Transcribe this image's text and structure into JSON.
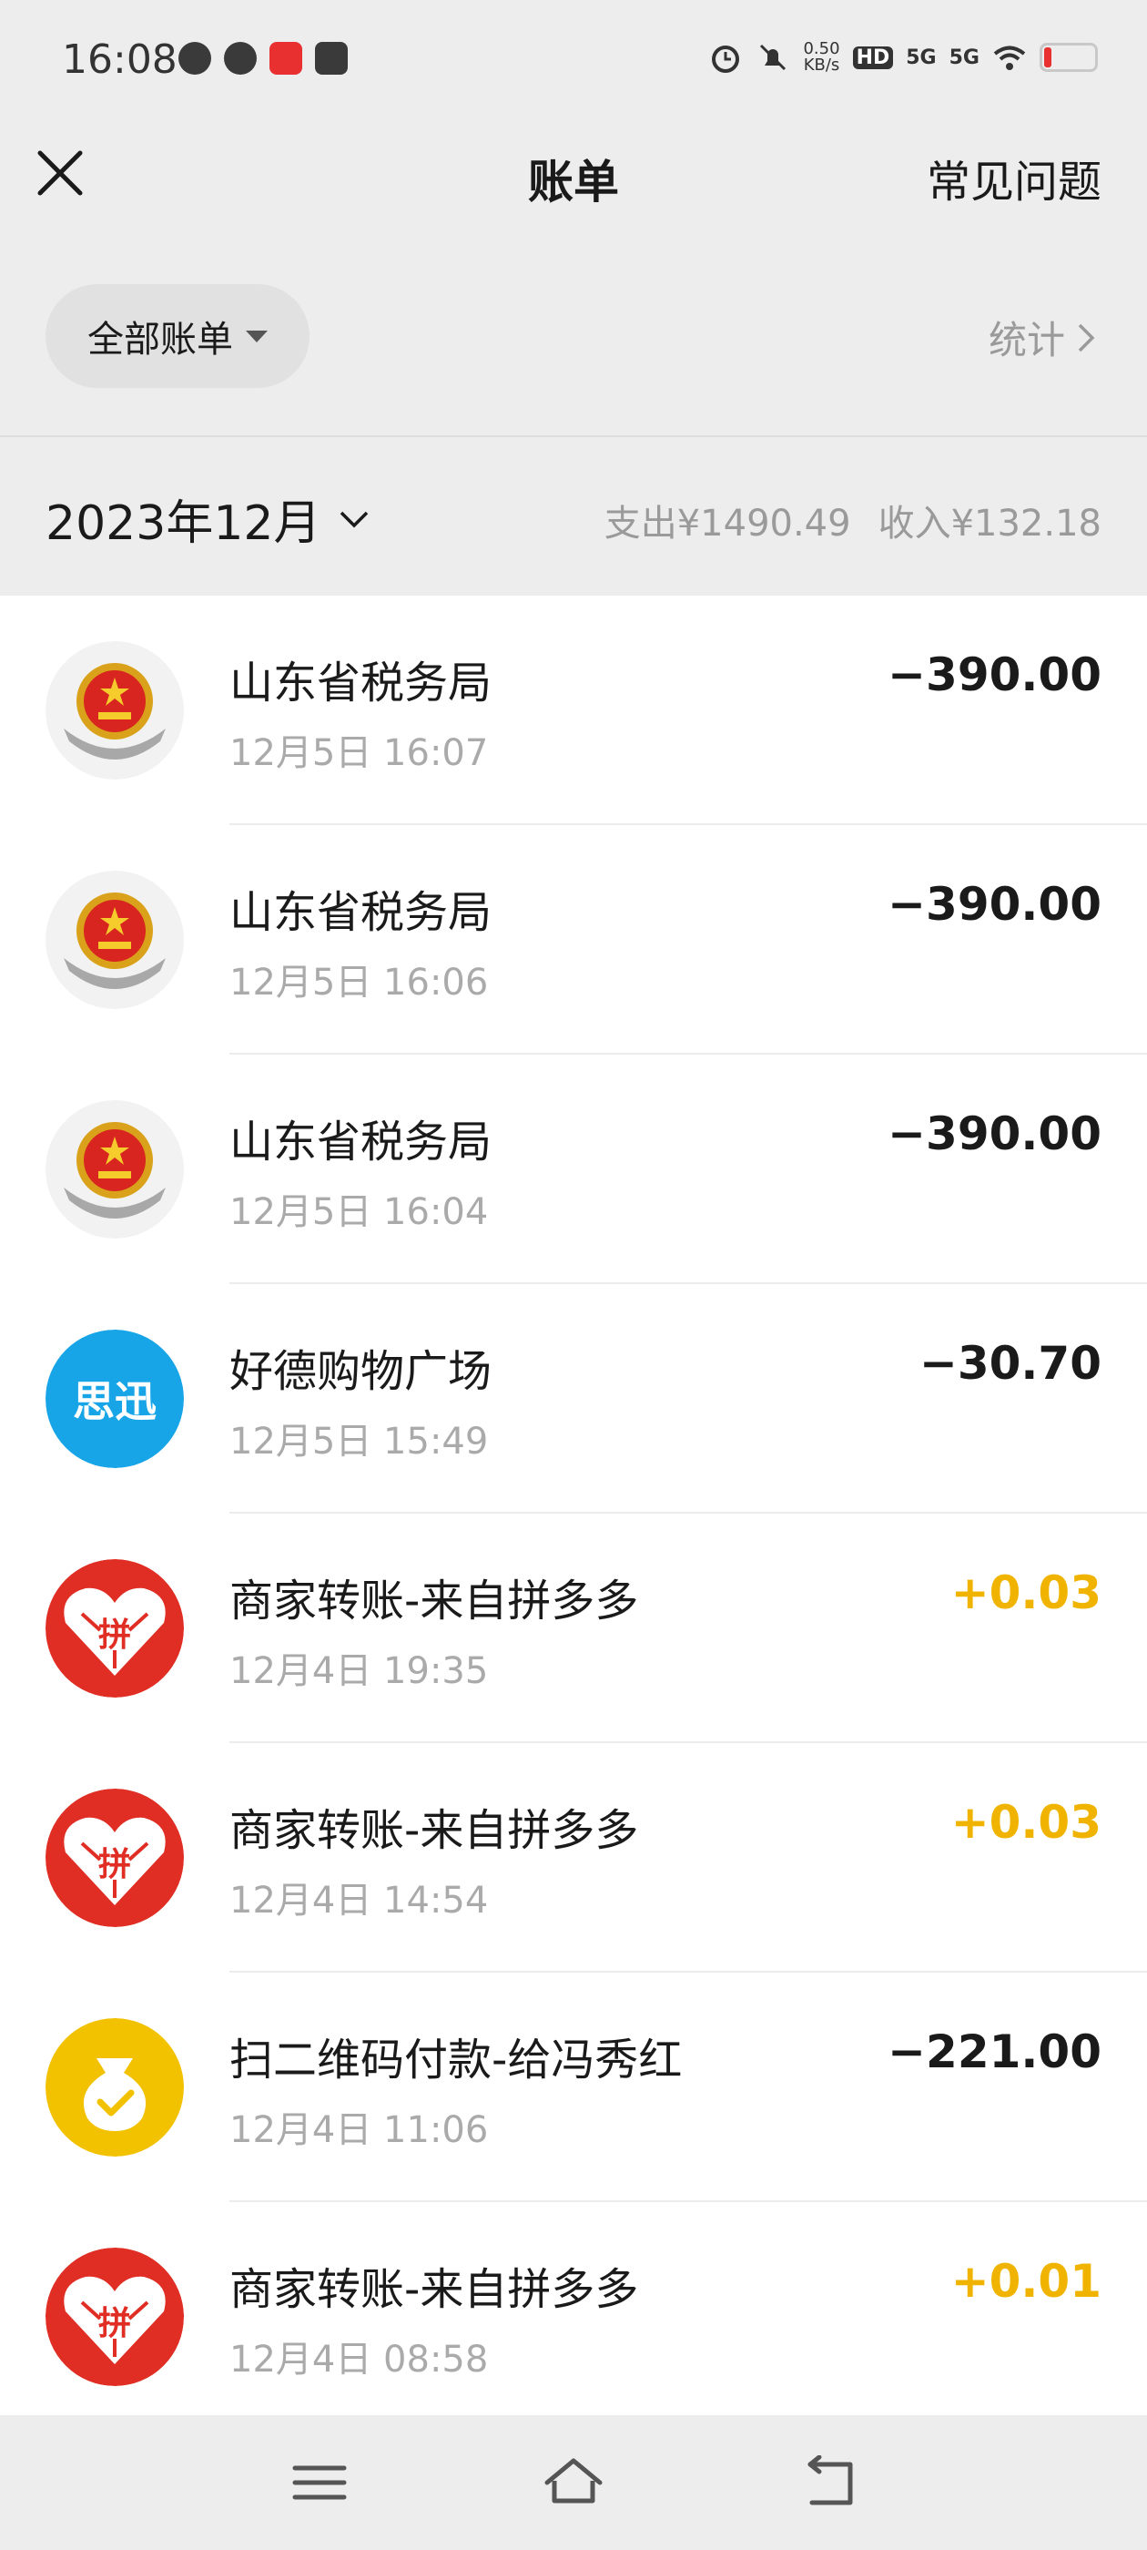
{
  "status_bar": {
    "time": "16:08",
    "net_speed_value": "0.50",
    "net_speed_unit": "KB/s",
    "hd_label": "HD",
    "signal1": "5G",
    "signal2": "5G"
  },
  "header": {
    "title": "账单",
    "faq_label": "常见问题"
  },
  "filter": {
    "all_bills_label": "全部账单",
    "stats_label": "统计"
  },
  "month": {
    "label": "2023年12月",
    "expense_summary": "支出¥1490.49",
    "income_summary": "收入¥132.18"
  },
  "transactions": [
    {
      "name": "山东省税务局",
      "time": "12月5日 16:07",
      "amount": "−390.00",
      "kind": "emblem",
      "sign": "neg"
    },
    {
      "name": "山东省税务局",
      "time": "12月5日 16:06",
      "amount": "−390.00",
      "kind": "emblem",
      "sign": "neg"
    },
    {
      "name": "山东省税务局",
      "time": "12月5日 16:04",
      "amount": "−390.00",
      "kind": "emblem",
      "sign": "neg"
    },
    {
      "name": "好德购物广场",
      "time": "12月5日 15:49",
      "amount": "−30.70",
      "kind": "sixun",
      "sign": "neg",
      "logo_text": "思迅"
    },
    {
      "name": "商家转账-来自拼多多",
      "time": "12月4日 19:35",
      "amount": "+0.03",
      "kind": "pdd",
      "sign": "pos",
      "logo_text": "拼"
    },
    {
      "name": "商家转账-来自拼多多",
      "time": "12月4日 14:54",
      "amount": "+0.03",
      "kind": "pdd",
      "sign": "pos",
      "logo_text": "拼"
    },
    {
      "name": "扫二维码付款-给冯秀红",
      "time": "12月4日 11:06",
      "amount": "−221.00",
      "kind": "qrpay",
      "sign": "neg"
    },
    {
      "name": "商家转账-来自拼多多",
      "time": "12月4日 08:58",
      "amount": "+0.01",
      "kind": "pdd",
      "sign": "pos",
      "logo_text": "拼"
    }
  ],
  "colors": {
    "positive_amount": "#f0b400",
    "negative_amount": "#1a1a1a",
    "pdd_red": "#e02e24",
    "sixun_blue": "#17a5e8",
    "qrpay_yellow": "#f2c200"
  }
}
